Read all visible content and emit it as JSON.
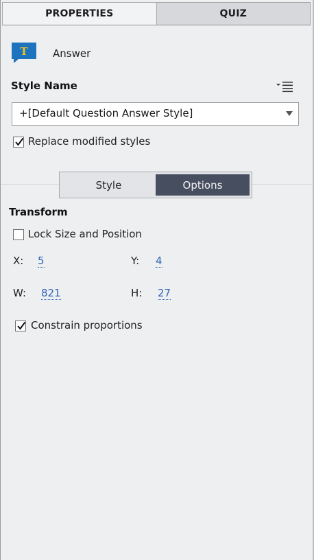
{
  "tabs": [
    {
      "label": "PROPERTIES",
      "active": true
    },
    {
      "label": "QUIZ",
      "active": false
    }
  ],
  "object": {
    "icon": "text-caption-icon",
    "icon_letter": "T",
    "name": "Answer"
  },
  "style_name": {
    "label": "Style Name",
    "menu_icon": "options-menu-icon",
    "selected_value": "+[Default Question Answer Style]"
  },
  "replace_modified": {
    "label": "Replace modified styles",
    "checked": true
  },
  "segmented": {
    "style_label": "Style",
    "options_label": "Options",
    "selected": "Options"
  },
  "transform": {
    "title": "Transform",
    "lock_label": "Lock Size and Position",
    "lock_checked": false,
    "x_label": "X:",
    "x_value": "5",
    "y_label": "Y:",
    "y_value": "4",
    "w_label": "W:",
    "w_value": "821",
    "h_label": "H:",
    "h_value": "27",
    "constrain_label": "Constrain proportions",
    "constrain_checked": true
  },
  "colors": {
    "accent_blue": "#1e73be",
    "icon_letter": "#f0c419",
    "selected_segment": "#474e5f",
    "value_link": "#2e64b5"
  }
}
